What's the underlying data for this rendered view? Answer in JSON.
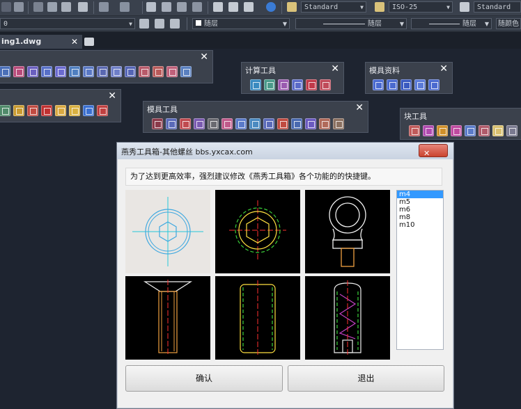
{
  "toolbar": {
    "text_style": "Standard",
    "dim_style": "ISO-25",
    "table_style": "Standard"
  },
  "layer_bar": {
    "layer_value": "0",
    "color": "随层",
    "linetype": "随层",
    "lineweight": "随层",
    "plot_style": "随颜色"
  },
  "tab": {
    "label": "ing1.dwg"
  },
  "palettes": {
    "calc": {
      "title": "计算工具"
    },
    "mold_data": {
      "title": "模具资料"
    },
    "mold_tools": {
      "title": "模具工具"
    },
    "block_tools": {
      "title": "块工具"
    }
  },
  "dialog": {
    "title": "燕秀工具箱-其他螺丝  bbs.yxcax.com",
    "message": "为了达到更高效率，强烈建议修改《燕秀工具箱》各个功能的的快捷键。",
    "sizes": [
      "m4",
      "m5",
      "m6",
      "m8",
      "m10"
    ],
    "selected_size": "m4",
    "ok_label": "确认",
    "exit_label": "退出"
  },
  "colors": {
    "bg": "#1e2430",
    "palette": "#3b414c",
    "selection": "#3399ff",
    "close_button": "#c9442f"
  }
}
